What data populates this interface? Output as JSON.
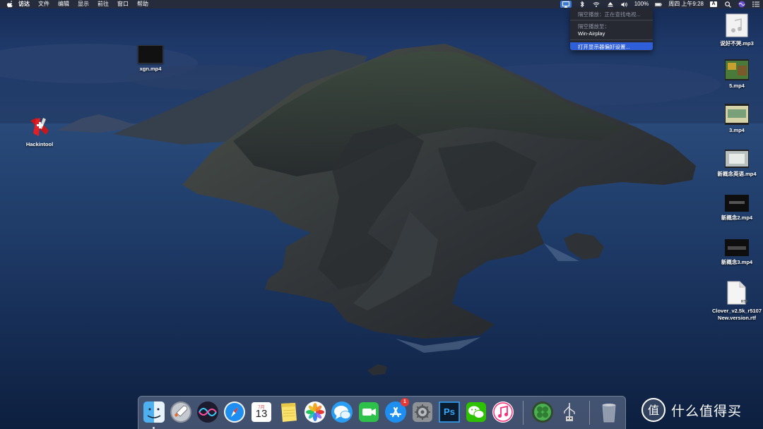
{
  "menubar": {
    "apple_icon": "apple-logo-icon",
    "items": [
      "访达",
      "文件",
      "编辑",
      "显示",
      "前往",
      "窗口",
      "帮助"
    ],
    "status": {
      "battery_text": "100%",
      "clock_text": "周四 上午9:28",
      "input_source": "A"
    }
  },
  "airplay_menu": {
    "status_label": "隔空播放：正在查找电视...",
    "section_label": "隔空播放至：",
    "device_name": "Win-Airplay",
    "open_display_prefs": "打开显示器偏好设置..."
  },
  "desktop_icons": [
    {
      "label": "xgn.mp4"
    },
    {
      "label": "Hackintool"
    },
    {
      "label": "说好不哭.mp3"
    },
    {
      "label": "5.mp4"
    },
    {
      "label": "3.mp4"
    },
    {
      "label": "新概念英语.mp4"
    },
    {
      "label": "新概念2.mp4"
    },
    {
      "label": "新概念3.mp4"
    },
    {
      "label": "Clover_v2.5k_r5107 New.version.rtf"
    },
    {
      "rtf_badge": "RTF"
    }
  ],
  "dock": {
    "apps": [
      {
        "name": "finder",
        "icon": "finder-icon"
      },
      {
        "name": "launchpad",
        "icon": "rocket-icon"
      },
      {
        "name": "siri",
        "icon": "siri-icon"
      },
      {
        "name": "safari",
        "icon": "compass-icon"
      },
      {
        "name": "calendar",
        "icon": "calendar-icon",
        "month": "7月",
        "day": "13"
      },
      {
        "name": "notes",
        "icon": "notes-icon"
      },
      {
        "name": "photos",
        "icon": "photos-icon"
      },
      {
        "name": "messages",
        "icon": "chat-bubble-icon"
      },
      {
        "name": "facetime",
        "icon": "video-camera-icon"
      },
      {
        "name": "app-store",
        "icon": "app-store-icon",
        "badge": "1"
      },
      {
        "name": "system-preferences",
        "icon": "gear-icon"
      },
      {
        "name": "photoshop",
        "icon": "photoshop-icon",
        "text": "Ps"
      },
      {
        "name": "wechat",
        "icon": "wechat-icon"
      },
      {
        "name": "itunes",
        "icon": "music-note-icon"
      },
      {
        "name": "clover-configurator",
        "icon": "clover-icon"
      },
      {
        "name": "usb-tool",
        "icon": "usb-icon"
      },
      {
        "name": "trash",
        "icon": "trash-icon"
      }
    ]
  },
  "watermark": {
    "symbol": "值",
    "text": "什么值得买"
  },
  "colors": {
    "menu_highlight": "#2f5fd8",
    "badge_red": "#e53935",
    "wechat_green": "#2dc100"
  }
}
